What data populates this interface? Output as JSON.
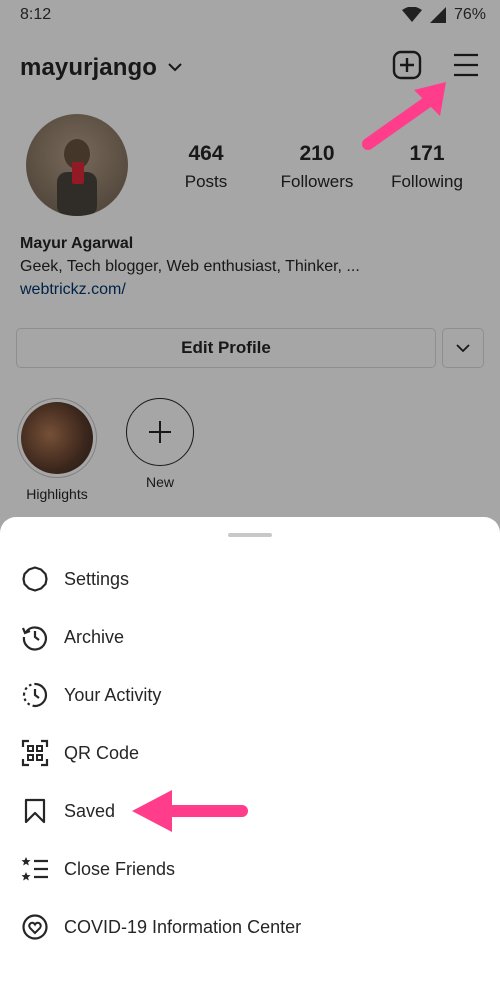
{
  "status_bar": {
    "time": "8:12",
    "battery": "76%"
  },
  "profile": {
    "username": "mayurjango",
    "stats": [
      {
        "value": "464",
        "label": "Posts"
      },
      {
        "value": "210",
        "label": "Followers"
      },
      {
        "value": "171",
        "label": "Following"
      }
    ],
    "name": "Mayur Agarwal",
    "bio": "Geek, Tech blogger, Web enthusiast, Thinker, ...",
    "website": "webtrickz.com/",
    "edit_button": "Edit Profile"
  },
  "highlights": [
    {
      "label": "Highlights"
    },
    {
      "label": "New"
    }
  ],
  "menu": {
    "items": [
      {
        "label": "Settings",
        "icon": "settings-icon"
      },
      {
        "label": "Archive",
        "icon": "archive-icon"
      },
      {
        "label": "Your Activity",
        "icon": "activity-icon"
      },
      {
        "label": "QR Code",
        "icon": "qr-code-icon"
      },
      {
        "label": "Saved",
        "icon": "bookmark-icon"
      },
      {
        "label": "Close Friends",
        "icon": "close-friends-icon"
      },
      {
        "label": "COVID-19 Information Center",
        "icon": "covid-info-icon"
      }
    ]
  },
  "colors": {
    "annotation_arrow": "#ff3d8b",
    "link": "#00376b",
    "overlay": "rgba(0,0,0,0.35)"
  }
}
